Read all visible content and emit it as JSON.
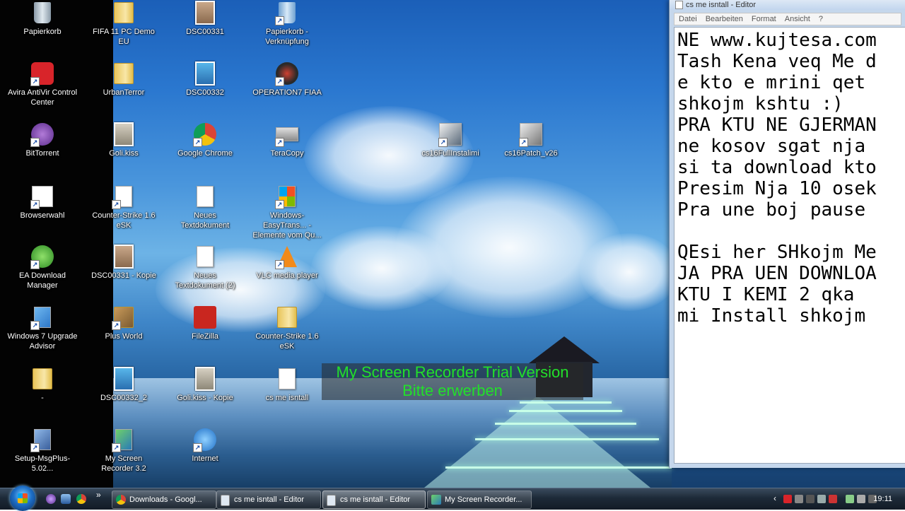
{
  "desktop_icons": [
    {
      "name": "desktop-icon-papierkorb",
      "label": "Papierkorb",
      "icon": "recycle-bin-icon"
    },
    {
      "name": "desktop-icon-avira",
      "label": "Avira AntiVir Control Center",
      "icon": "avira-icon"
    },
    {
      "name": "desktop-icon-bittorrent",
      "label": "BitTorrent",
      "icon": "bittorrent-icon"
    },
    {
      "name": "desktop-icon-browserwahl",
      "label": "Browserwahl",
      "icon": "browser-choice-icon"
    },
    {
      "name": "desktop-icon-ea-download-manager",
      "label": "EA Download Manager",
      "icon": "ea-icon"
    },
    {
      "name": "desktop-icon-win7-upgrade",
      "label": "Windows 7 Upgrade Advisor",
      "icon": "windows-upgrade-icon"
    },
    {
      "name": "desktop-icon-dash-folder",
      "label": "-",
      "icon": "folder-icon"
    },
    {
      "name": "desktop-icon-setup-msgplus",
      "label": "Setup-MsgPlus-5.02...",
      "icon": "setup-icon"
    },
    {
      "name": "desktop-icon-fifa11",
      "label": "FIFA 11 PC Demo EU",
      "icon": "folder-icon"
    },
    {
      "name": "desktop-icon-urbanterror",
      "label": "UrbanTerror",
      "icon": "folder-icon"
    },
    {
      "name": "desktop-icon-golikiss",
      "label": "Goli.kiss",
      "icon": "photo-icon"
    },
    {
      "name": "desktop-icon-counter-strike-esk-a",
      "label": "Counter-Strike 1.6 eSK",
      "icon": "calendar-icon"
    },
    {
      "name": "desktop-icon-dsc00331-kopie",
      "label": "DSC00331 - Kopie",
      "icon": "photo-icon"
    },
    {
      "name": "desktop-icon-plus-world",
      "label": "Plus World",
      "icon": "plus-world-icon"
    },
    {
      "name": "desktop-icon-dsc00332-2",
      "label": "DSC00332_2",
      "icon": "photo-icon"
    },
    {
      "name": "desktop-icon-my-screen-recorder",
      "label": "My Screen Recorder 3.2",
      "icon": "screen-recorder-icon"
    },
    {
      "name": "desktop-icon-dsc00331",
      "label": "DSC00331",
      "icon": "photo-icon"
    },
    {
      "name": "desktop-icon-dsc00332",
      "label": "DSC00332",
      "icon": "photo-icon"
    },
    {
      "name": "desktop-icon-google-chrome",
      "label": "Google Chrome",
      "icon": "chrome-icon"
    },
    {
      "name": "desktop-icon-neues-textdokument",
      "label": "Neues Textdokument",
      "icon": "document-icon"
    },
    {
      "name": "desktop-icon-neues-textdokument-2",
      "label": "Neues Textdokument (2)",
      "icon": "document-icon"
    },
    {
      "name": "desktop-icon-filezilla",
      "label": "FileZilla",
      "icon": "filezilla-icon"
    },
    {
      "name": "desktop-icon-golikiss-kopie",
      "label": "Goli.kiss - Kopie",
      "icon": "photo-icon"
    },
    {
      "name": "desktop-icon-internet",
      "label": "Internet",
      "icon": "internet-explorer-icon"
    },
    {
      "name": "desktop-icon-papierkorb-verknuepfung",
      "label": "Papierkorb - Verknüpfung",
      "icon": "recycle-bin-icon"
    },
    {
      "name": "desktop-icon-operation7",
      "label": "OPERATION7 FIAA",
      "icon": "operation7-icon"
    },
    {
      "name": "desktop-icon-teracopy",
      "label": "TeraCopy",
      "icon": "teracopy-icon"
    },
    {
      "name": "desktop-icon-windows-easytransfer",
      "label": "Windows-EasyTrans... - Elemente vom Qu...",
      "icon": "easy-transfer-icon"
    },
    {
      "name": "desktop-icon-vlc",
      "label": "VLC media player",
      "icon": "vlc-icon"
    },
    {
      "name": "desktop-icon-counter-strike-esk-b",
      "label": "Counter-Strike 1.6 eSK",
      "icon": "folder-icon"
    },
    {
      "name": "desktop-icon-cs-me-isntall",
      "label": "cs me isntall",
      "icon": "document-icon"
    },
    {
      "name": "desktop-icon-cs16fullinstalimi",
      "label": "cs16FullInstalimi",
      "icon": "cs-installer-icon"
    },
    {
      "name": "desktop-icon-cs16patch",
      "label": "cs16Patch_v26",
      "icon": "cs-patch-icon"
    }
  ],
  "watermark": {
    "line1": "My Screen Recorder Trial Version",
    "line2": "Bitte erwerben"
  },
  "editor": {
    "title": "cs me isntall - Editor",
    "menu": [
      "Datei",
      "Bearbeiten",
      "Format",
      "Ansicht",
      "?"
    ],
    "lines": [
      "NE www.kujtesa.com",
      "Tash Kena veq Me d",
      "e kto e mrini qet",
      "shkojm kshtu :)",
      "PRA KTU NE GJERMAN",
      "ne kosov sgat nja",
      "si ta download kto",
      "Presim Nja 10 osek",
      "Pra une boj pause",
      "",
      "QEsi her SHkojm Me",
      "JA PRA UEN DOWNLOA",
      "KTU I KEMI 2 qka",
      "mi Install shkojm"
    ]
  },
  "taskbar": {
    "overflow": "»",
    "buttons": [
      {
        "label": "Downloads - Googl...",
        "icon": "chrome-icon"
      },
      {
        "label": "cs me isntall - Editor",
        "icon": "notepad-icon"
      },
      {
        "label": "cs me isntall - Editor",
        "icon": "notepad-icon"
      },
      {
        "label": "My Screen Recorder...",
        "icon": "screen-recorder-icon"
      }
    ],
    "tray_show_hidden": "‹",
    "clock": "19:11"
  },
  "colors": {
    "watermark_text": "#22e02a",
    "taskbar": "#1d2a38"
  }
}
